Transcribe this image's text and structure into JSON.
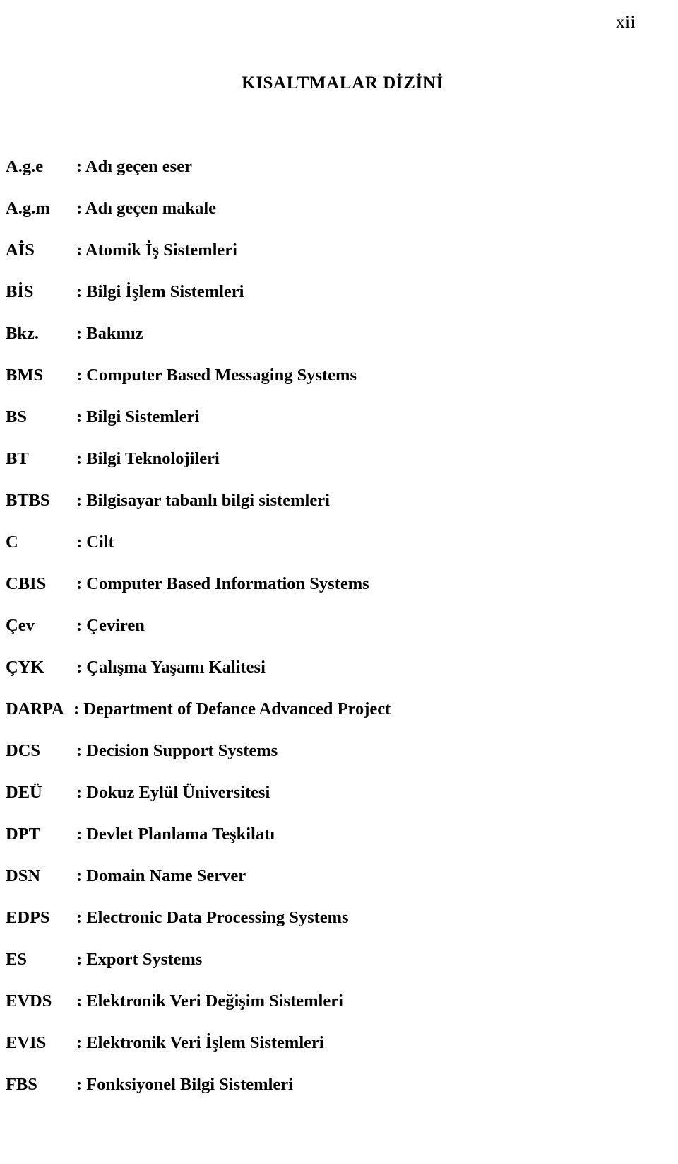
{
  "page": {
    "number": "xii",
    "title": "KISALTMALAR DİZİNİ"
  },
  "abbreviations": [
    {
      "term": "A.g.e",
      "definition": ": Adı geçen eser"
    },
    {
      "term": "A.g.m",
      "definition": ": Adı geçen makale"
    },
    {
      "term": "AİS",
      "definition": ": Atomik İş Sistemleri"
    },
    {
      "term": "BİS",
      "definition": ": Bilgi İşlem Sistemleri"
    },
    {
      "term": "Bkz.",
      "definition": ": Bakınız"
    },
    {
      "term": "BMS",
      "definition": ": Computer Based Messaging Systems"
    },
    {
      "term": "BS",
      "definition": ": Bilgi Sistemleri"
    },
    {
      "term": "BT",
      "definition": ": Bilgi Teknolojileri"
    },
    {
      "term": "BTBS",
      "definition": ": Bilgisayar tabanlı bilgi sistemleri"
    },
    {
      "term": "C",
      "definition": ": Cilt"
    },
    {
      "term": "CBIS",
      "definition": ": Computer Based Information Systems"
    },
    {
      "term": "Çev",
      "definition": ": Çeviren"
    },
    {
      "term": "ÇYK",
      "definition": ": Çalışma Yaşamı Kalitesi"
    },
    {
      "term": "DARPA",
      "definition": ": Department of Defance Advanced Project"
    },
    {
      "term": "DCS",
      "definition": ": Decision Support Systems"
    },
    {
      "term": "DEÜ",
      "definition": ": Dokuz Eylül Üniversitesi"
    },
    {
      "term": "DPT",
      "definition": ": Devlet Planlama Teşkilatı"
    },
    {
      "term": "DSN",
      "definition": ": Domain Name Server"
    },
    {
      "term": "EDPS",
      "definition": ": Electronic Data Processing Systems"
    },
    {
      "term": "ES",
      "definition": ": Export Systems"
    },
    {
      "term": "EVDS",
      "definition": ": Elektronik Veri Değişim Sistemleri"
    },
    {
      "term": "EVIS",
      "definition": ": Elektronik Veri İşlem Sistemleri"
    },
    {
      "term": "FBS",
      "definition": ": Fonksiyonel Bilgi Sistemleri"
    }
  ]
}
